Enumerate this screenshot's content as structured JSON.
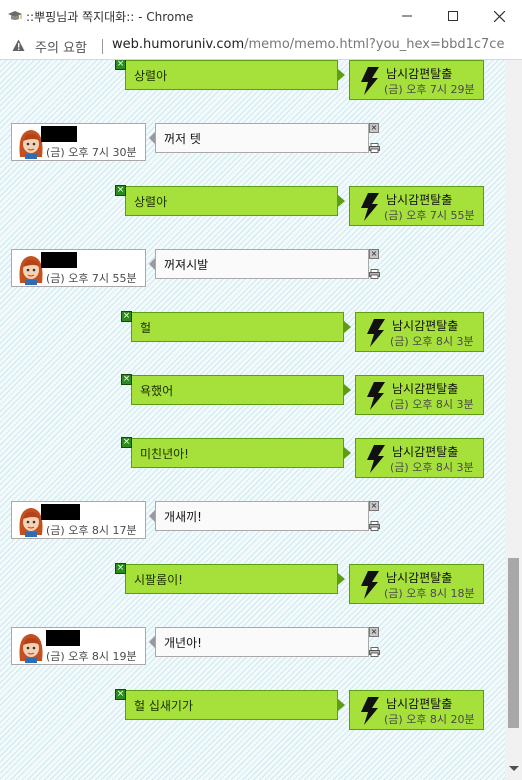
{
  "window": {
    "title": "::뿌핑님과 쪽지대화:: - Chrome",
    "icon": "graduation-cap-icon"
  },
  "addressbar": {
    "warning_label": "주의 요함",
    "url_host": "web.humoruniv.com",
    "url_path": "/memo/memo.html?you_hex=bbd1c7ce"
  },
  "colors": {
    "sent_bubble": "#a6e03b",
    "sent_border": "#5d9d16",
    "background_stripe": "#cfe9ef"
  },
  "messages": [
    {
      "type": "sent",
      "text": "상렬아",
      "sender": "남시감편탈출",
      "time": "(금) 오후 7시 29분"
    },
    {
      "type": "received",
      "text": "꺼저 텟",
      "time": "(금) 오후 7시 30분"
    },
    {
      "type": "sent",
      "text": "상렬아",
      "sender": "남시감편탈출",
      "time": "(금) 오후 7시 55분"
    },
    {
      "type": "received",
      "text": "꺼져시발",
      "time": "(금) 오후 7시 55분"
    },
    {
      "type": "sent",
      "text": "헐",
      "sender": "남시감편탈출",
      "time": "(금) 오후 8시 3분"
    },
    {
      "type": "sent",
      "text": "욕했어",
      "sender": "남시감편탈출",
      "time": "(금) 오후 8시 3분"
    },
    {
      "type": "sent",
      "text": "미친년아!",
      "sender": "남시감편탈출",
      "time": "(금) 오후 8시 3분"
    },
    {
      "type": "received",
      "text": "개새끼!",
      "time": "(금) 오후 8시 17분"
    },
    {
      "type": "sent",
      "text": "시팔롬이!",
      "sender": "남시감편탈출",
      "time": "(금) 오후 8시 18분"
    },
    {
      "type": "received",
      "text": "개년아!",
      "time": "(금) 오후 8시 19분"
    },
    {
      "type": "sent",
      "text": "헐 십새기가",
      "sender": "남시감편탈출",
      "time": "(금) 오후 8시 20분"
    }
  ]
}
